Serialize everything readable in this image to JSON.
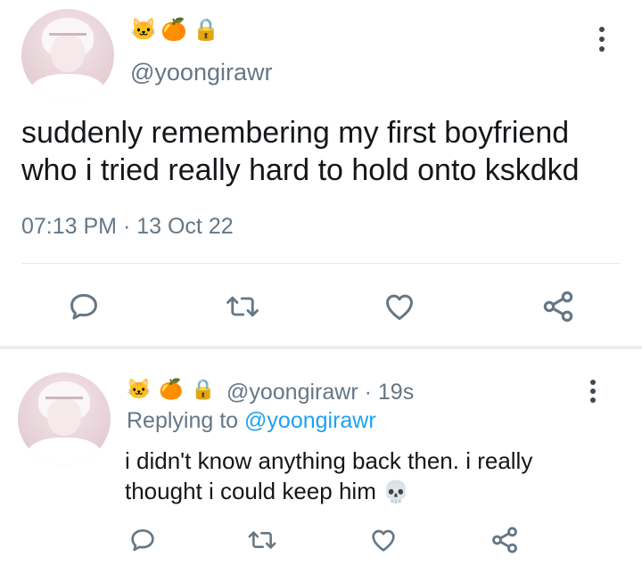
{
  "main_tweet": {
    "emojis": [
      "🐱",
      "🍊",
      "🔒"
    ],
    "handle": "@yoongirawr",
    "text_line1": "suddenly remembering my first boyfriend",
    "text_line2": "who i tried really hard to hold onto kskdkd",
    "timestamp": "07:13 PM · 13 Oct 22",
    "icons": {
      "reply": "speech-bubble-icon",
      "retweet": "retweet-icon",
      "like": "heart-icon",
      "share": "share-icon",
      "more": "more-vertical-icon"
    }
  },
  "reply_tweet": {
    "emojis": [
      "🐱",
      "🍊",
      "🔒"
    ],
    "handle": "@yoongirawr",
    "time_ago": "19s",
    "replying_prefix": "Replying to",
    "replying_handle": "@yoongirawr",
    "text_line1": "i didn't know anything back then. i really",
    "text_line2": "thought i could keep him",
    "trailing_emoji": "💀"
  },
  "colors": {
    "text": "#14171a",
    "secondary": "#657786",
    "link": "#1da1f2",
    "icon": "#657786",
    "divider": "#e1e8ed"
  }
}
